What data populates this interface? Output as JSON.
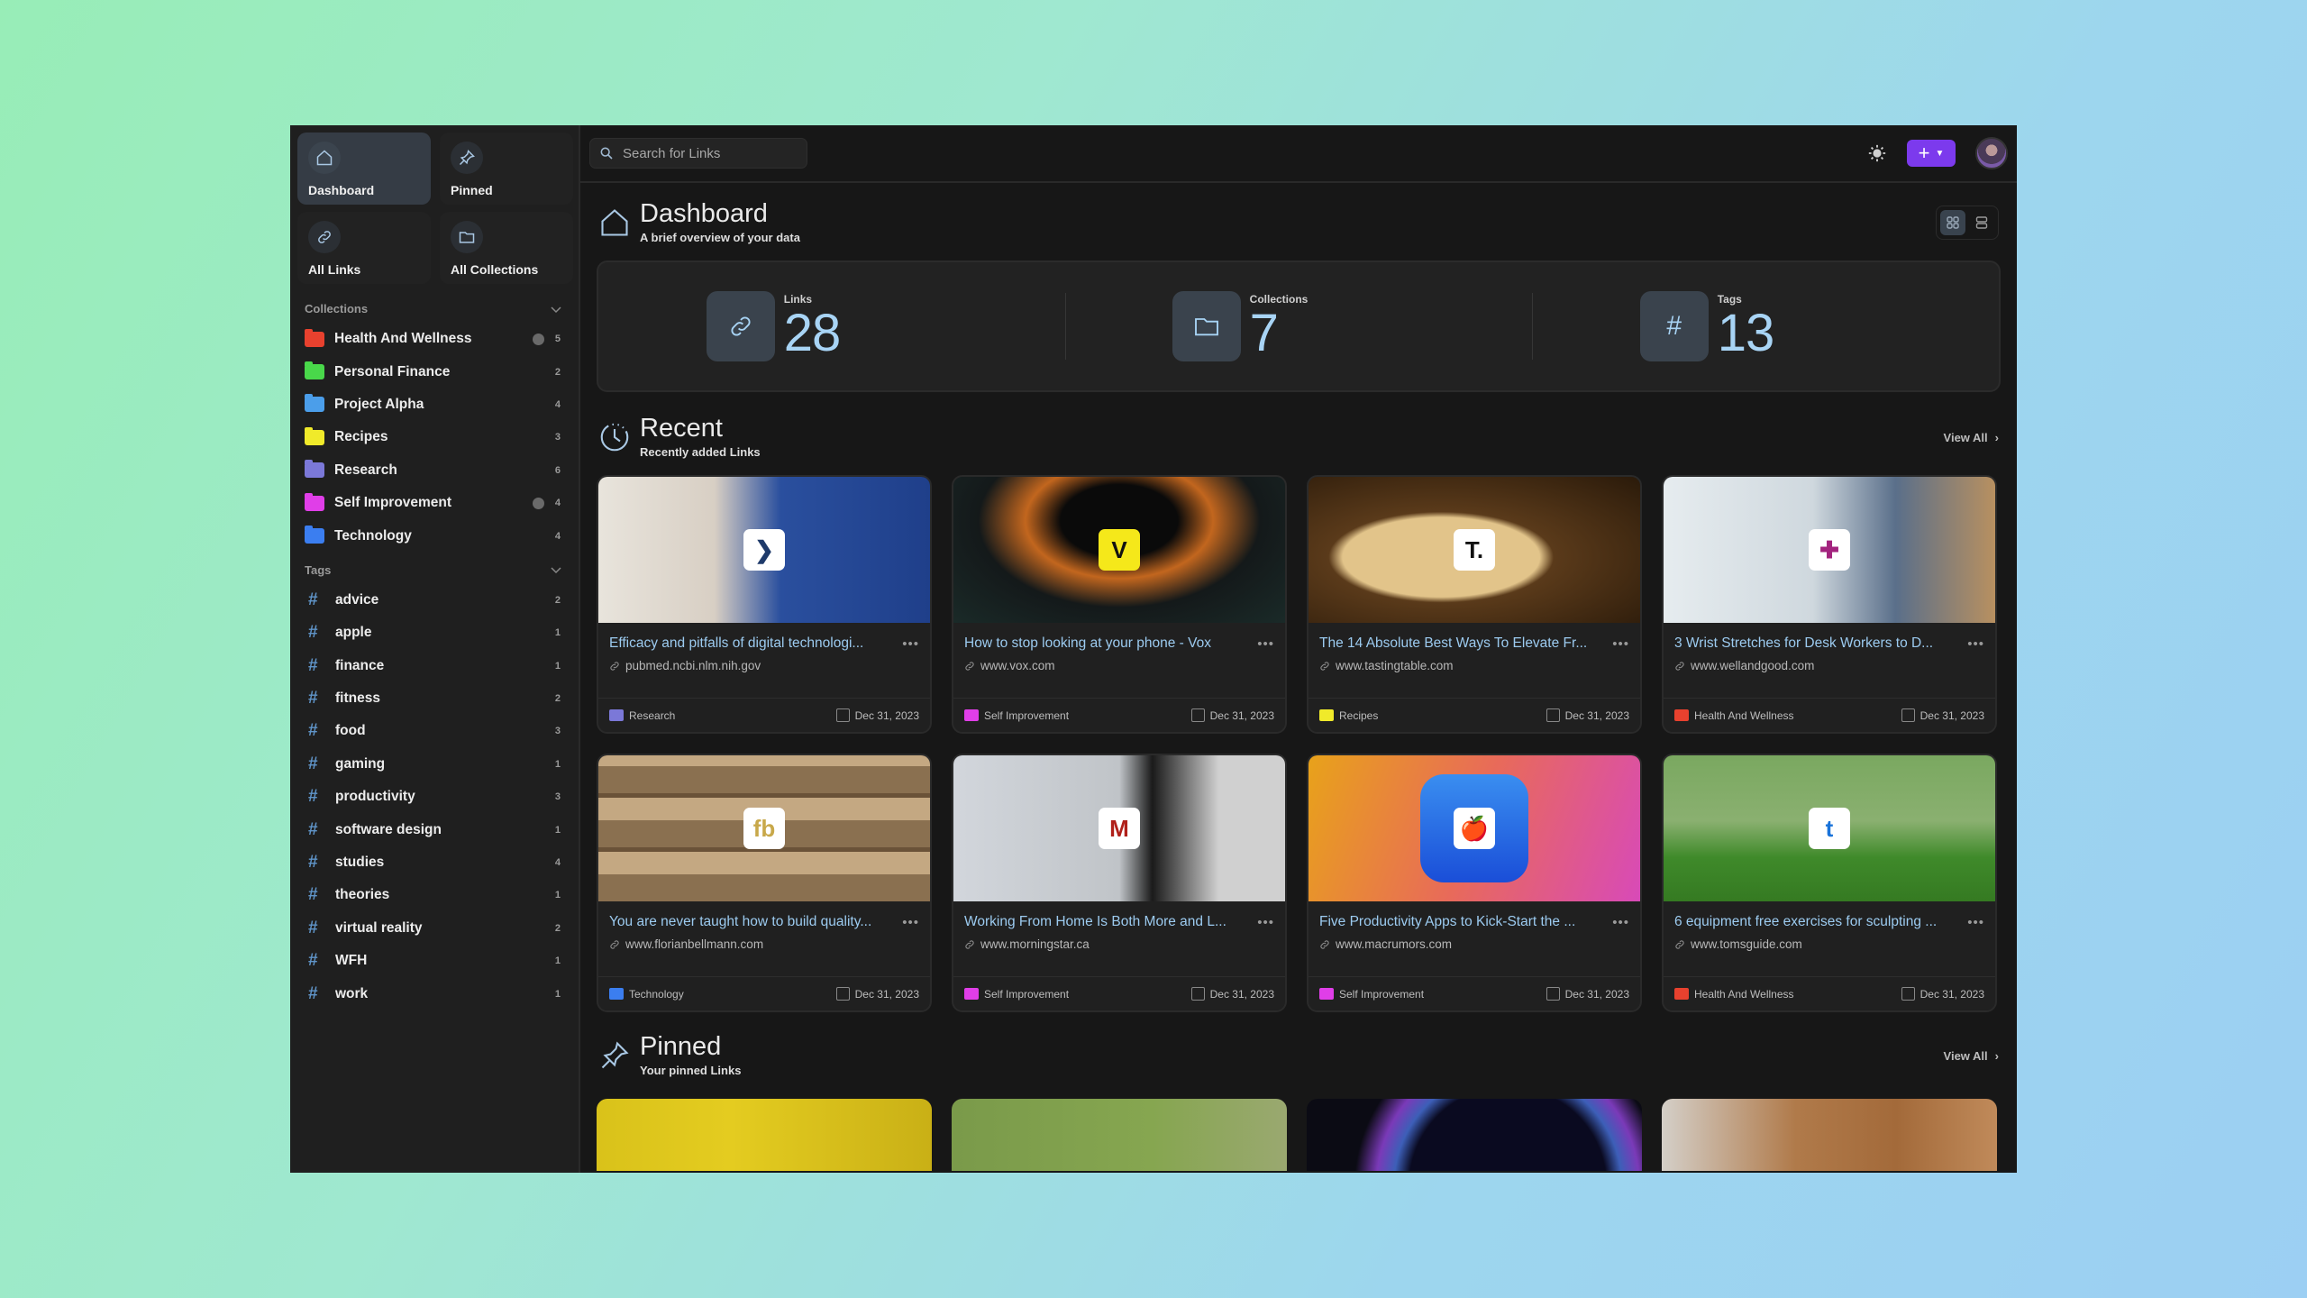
{
  "sidebar": {
    "nav": [
      {
        "label": "Dashboard",
        "icon": "home-icon",
        "active": true
      },
      {
        "label": "Pinned",
        "icon": "pin-icon",
        "active": false
      },
      {
        "label": "All Links",
        "icon": "link-icon",
        "active": false
      },
      {
        "label": "All Collections",
        "icon": "folder-icon",
        "active": false
      }
    ],
    "collections_header": "Collections",
    "collections": [
      {
        "name": "Health And Wellness",
        "count": "5",
        "color": "#e8412e",
        "public": true
      },
      {
        "name": "Personal Finance",
        "count": "2",
        "color": "#49d84a",
        "public": false
      },
      {
        "name": "Project Alpha",
        "count": "4",
        "color": "#4b9eea",
        "public": false
      },
      {
        "name": "Recipes",
        "count": "3",
        "color": "#f0ea2a",
        "public": false
      },
      {
        "name": "Research",
        "count": "6",
        "color": "#7b78d8",
        "public": false
      },
      {
        "name": "Self Improvement",
        "count": "4",
        "color": "#e03ee8",
        "public": true
      },
      {
        "name": "Technology",
        "count": "4",
        "color": "#3b7ef0",
        "public": false
      }
    ],
    "tags_header": "Tags",
    "tags": [
      {
        "name": "advice",
        "count": "2"
      },
      {
        "name": "apple",
        "count": "1"
      },
      {
        "name": "finance",
        "count": "1"
      },
      {
        "name": "fitness",
        "count": "2"
      },
      {
        "name": "food",
        "count": "3"
      },
      {
        "name": "gaming",
        "count": "1"
      },
      {
        "name": "productivity",
        "count": "3"
      },
      {
        "name": "software design",
        "count": "1"
      },
      {
        "name": "studies",
        "count": "4"
      },
      {
        "name": "theories",
        "count": "1"
      },
      {
        "name": "virtual reality",
        "count": "2"
      },
      {
        "name": "WFH",
        "count": "1"
      },
      {
        "name": "work",
        "count": "1"
      }
    ]
  },
  "topbar": {
    "search_placeholder": "Search for Links",
    "theme_icon": "sun-icon",
    "add_button_label": "+",
    "accent": "#7c3aed"
  },
  "dashboard": {
    "title": "Dashboard",
    "subtitle": "A brief overview of your data",
    "stats": [
      {
        "label": "Links",
        "value": "28",
        "icon": "link-icon"
      },
      {
        "label": "Collections",
        "value": "7",
        "icon": "folder-icon"
      },
      {
        "label": "Tags",
        "value": "13",
        "icon": "hash-icon"
      }
    ]
  },
  "recent": {
    "title": "Recent",
    "subtitle": "Recently added Links",
    "view_all": "View All",
    "links": [
      {
        "title": "Efficacy and pitfalls of digital technologi...",
        "url": "pubmed.ncbi.nlm.nih.gov",
        "collection": "Research",
        "collection_color": "#7b78d8",
        "date": "Dec 31, 2023",
        "favicon": "❯",
        "favicon_color": "#1e3a6a"
      },
      {
        "title": "How to stop looking at your phone - Vox",
        "url": "www.vox.com",
        "collection": "Self Improvement",
        "collection_color": "#e03ee8",
        "date": "Dec 31, 2023",
        "favicon": "V",
        "favicon_color": "#111"
      },
      {
        "title": "The 14 Absolute Best Ways To Elevate Fr...",
        "url": "www.tastingtable.com",
        "collection": "Recipes",
        "collection_color": "#f0ea2a",
        "date": "Dec 31, 2023",
        "favicon": "T.",
        "favicon_color": "#111"
      },
      {
        "title": "3 Wrist Stretches for Desk Workers to D...",
        "url": "www.wellandgood.com",
        "collection": "Health And Wellness",
        "collection_color": "#e8412e",
        "date": "Dec 31, 2023",
        "favicon": "✚",
        "favicon_color": "#a3237e"
      },
      {
        "title": "You are never taught how to build quality...",
        "url": "www.florianbellmann.com",
        "collection": "Technology",
        "collection_color": "#3b7ef0",
        "date": "Dec 31, 2023",
        "favicon": "fb",
        "favicon_color": "#c8a84a"
      },
      {
        "title": "Working From Home Is Both More and L...",
        "url": "www.morningstar.ca",
        "collection": "Self Improvement",
        "collection_color": "#e03ee8",
        "date": "Dec 31, 2023",
        "favicon": "M",
        "favicon_color": "#b0201a"
      },
      {
        "title": "Five Productivity Apps to Kick-Start the ...",
        "url": "www.macrumors.com",
        "collection": "Self Improvement",
        "collection_color": "#e03ee8",
        "date": "Dec 31, 2023",
        "favicon": "🍎",
        "favicon_color": "#c22"
      },
      {
        "title": "6 equipment free exercises for sculpting ...",
        "url": "www.tomsguide.com",
        "collection": "Health And Wellness",
        "collection_color": "#e8412e",
        "date": "Dec 31, 2023",
        "favicon": "t",
        "favicon_color": "#1a73d9"
      }
    ]
  },
  "pinned": {
    "title": "Pinned",
    "subtitle": "Your pinned Links",
    "view_all": "View All"
  }
}
